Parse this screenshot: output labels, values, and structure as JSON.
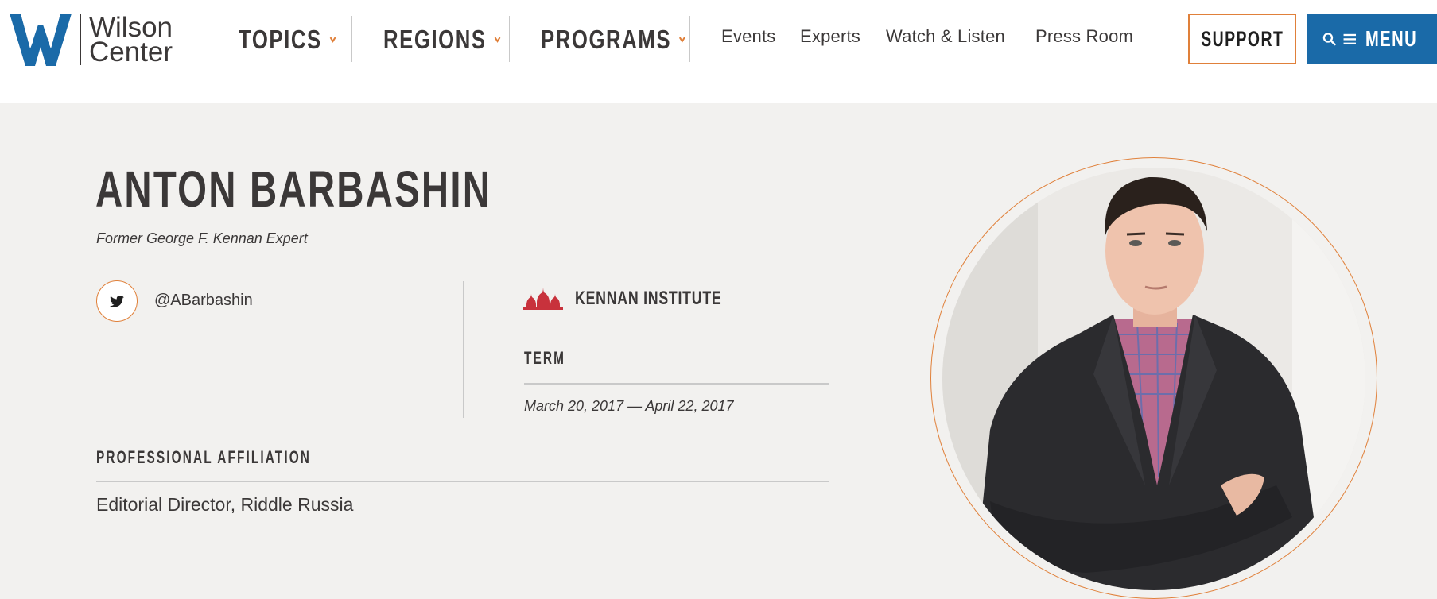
{
  "brand": {
    "name_line1": "Wilson",
    "name_line2": "Center",
    "logo_icon": "wilson-center-w-logo"
  },
  "nav": {
    "dropdowns": [
      {
        "label": "TOPICS"
      },
      {
        "label": "REGIONS"
      },
      {
        "label": "PROGRAMS"
      }
    ],
    "links": [
      {
        "label": "Events"
      },
      {
        "label": "Experts"
      },
      {
        "label": "Watch & Listen"
      },
      {
        "label": "Press Room"
      }
    ],
    "support_label": "SUPPORT",
    "menu_label": "MENU",
    "menu_icons": [
      "search-icon",
      "hamburger-icon"
    ]
  },
  "profile": {
    "name": "ANTON BARBASHIN",
    "title": "Former George F. Kennan Expert",
    "twitter_handle": "@ABarbashin",
    "program": "KENNAN INSTITUTE",
    "term_label": "TERM",
    "term_dates": "March 20, 2017 — April 22, 2017",
    "affiliation_label": "PROFESSIONAL AFFILIATION",
    "affiliation": "Editorial Director, Riddle Russia",
    "photo": "portrait-photo"
  },
  "colors": {
    "accent_orange": "#e0803a",
    "menu_blue": "#1a6aa8",
    "kennan_red": "#c8323c",
    "text_dark": "#3b3838",
    "background_grey": "#f2f1ef"
  }
}
